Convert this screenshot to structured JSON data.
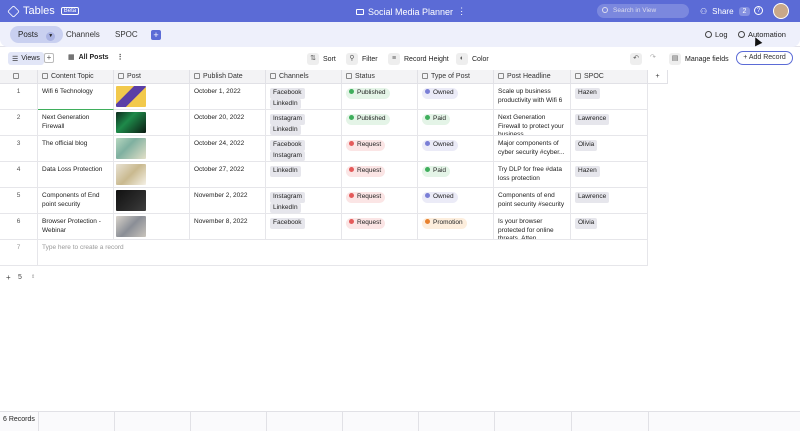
{
  "app": {
    "name": "Tables",
    "badge": "Beta",
    "doc_title": "Social Media Planner",
    "search_placeholder": "Search in View",
    "share_label": "Share",
    "share_count": "2",
    "help": "?"
  },
  "tabs": [
    {
      "label": "Posts",
      "active": true
    },
    {
      "label": "Channels"
    },
    {
      "label": "SPOC"
    }
  ],
  "right_tools": {
    "log": "Log",
    "automation": "Automation"
  },
  "toolbar": {
    "views": "Views",
    "view_name": "All Posts",
    "sort": "Sort",
    "filter": "Filter",
    "record_height": "Record Height",
    "color": "Color",
    "manage_fields": "Manage fields",
    "add_record": "+ Add Record"
  },
  "columns": [
    "Content Topic",
    "Post",
    "Publish Date",
    "Channels",
    "Status",
    "Type of Post",
    "Post Headline",
    "SPOC"
  ],
  "rows": [
    {
      "n": "1",
      "topic": "Wifi 6 Technology",
      "date": "October 1, 2022",
      "channels": [
        "Facebook",
        "LinkedIn"
      ],
      "status": "Published",
      "type": "Owned",
      "headline": "Scale up business productivity with Wifi 6 ...",
      "spoc": "Hazen"
    },
    {
      "n": "2",
      "topic": "Next Generation Firewall",
      "date": "October 20, 2022",
      "channels": [
        "Instagram",
        "LinkedIn"
      ],
      "status": "Published",
      "type": "Paid",
      "headline": "Next Generation Firewall to protect your business...",
      "spoc": "Lawrence"
    },
    {
      "n": "3",
      "topic": "The official blog",
      "date": "October 24, 2022",
      "channels": [
        "Facebook",
        "Instagram"
      ],
      "status": "Request",
      "type": "Owned",
      "headline": "Major components of cyber security #cyber...",
      "spoc": "Olivia"
    },
    {
      "n": "4",
      "topic": "Data Loss Protection",
      "date": "October 27, 2022",
      "channels": [
        "LinkedIn"
      ],
      "status": "Request",
      "type": "Paid",
      "headline": "Try DLP for free #data loss protection",
      "spoc": "Hazen"
    },
    {
      "n": "5",
      "topic": "Components of End point security",
      "date": "November 2, 2022",
      "channels": [
        "Instagram",
        "LinkedIn"
      ],
      "status": "Request",
      "type": "Owned",
      "headline": "Components of end point security #security",
      "spoc": "Lawrence"
    },
    {
      "n": "6",
      "topic": "Browser Protection - Webinar",
      "date": "November 8, 2022",
      "channels": [
        "Facebook"
      ],
      "status": "Request",
      "type": "Promotion",
      "headline": "Is your browser protected for online threats. Atten...",
      "spoc": "Olivia"
    }
  ],
  "new_row": {
    "n": "7",
    "placeholder": "Type here to create a record"
  },
  "pager": {
    "add": "+",
    "size": "5"
  },
  "footer": {
    "records": "6 Records"
  },
  "colors": {
    "accent": "#5b6bd6",
    "published": "#3fae5c",
    "request": "#e45a5a",
    "owned": "#7a7fd6",
    "paid": "#3fae5c",
    "promotion": "#e8812e"
  }
}
